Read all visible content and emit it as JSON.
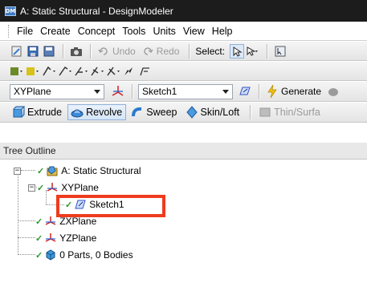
{
  "window": {
    "title": "A: Static Structural - DesignModeler",
    "app_badge": "DM"
  },
  "menu": [
    "File",
    "Create",
    "Concept",
    "Tools",
    "Units",
    "View",
    "Help"
  ],
  "toolbar1": {
    "undo_label": "Undo",
    "redo_label": "Redo",
    "select_label": "Select:"
  },
  "toolbar3": {
    "plane_value": "XYPlane",
    "sketch_value": "Sketch1",
    "generate_label": "Generate"
  },
  "toolbar4": {
    "extrude_label": "Extrude",
    "revolve_label": "Revolve",
    "sweep_label": "Sweep",
    "skinloft_label": "Skin/Loft",
    "thinsurface_label": "Thin/Surfa"
  },
  "tree": {
    "header": "Tree Outline",
    "root": "A: Static Structural",
    "xyplane": "XYPlane",
    "sketch": "Sketch1",
    "zxplane": "ZXPlane",
    "yzplane": "YZPlane",
    "bodies": "0 Parts, 0 Bodies"
  },
  "colors": {
    "highlight": "#ef3b1e",
    "titlebar": "#1c1c1c",
    "check": "#2a9a2a"
  }
}
